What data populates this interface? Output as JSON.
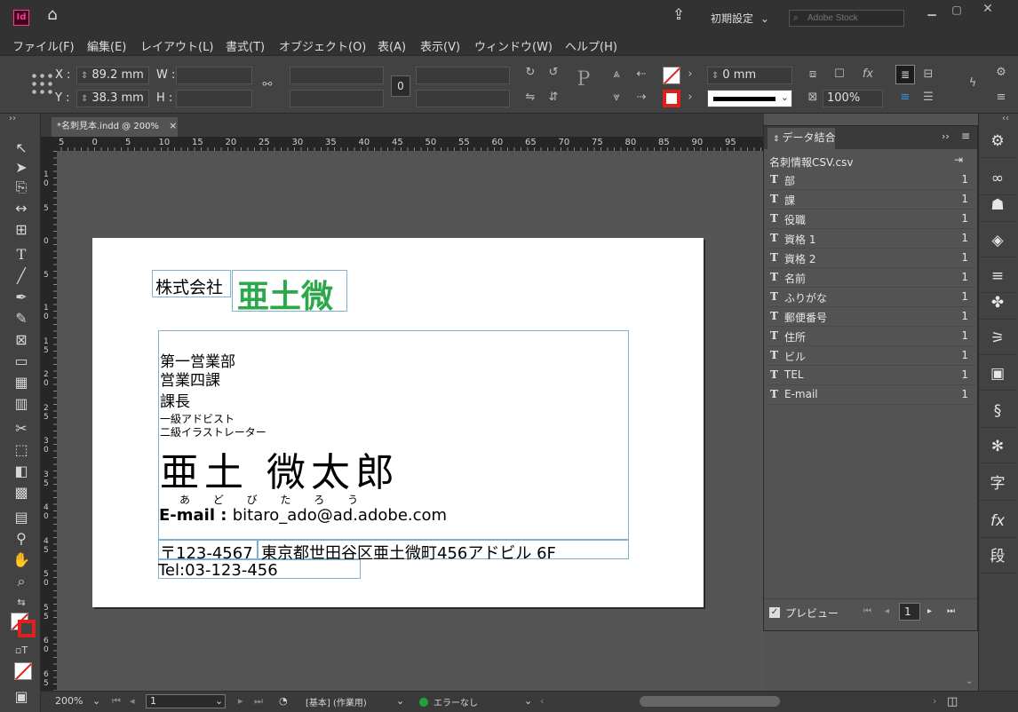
{
  "app": {
    "logo": "Id",
    "workspace": "初期設定",
    "search_placeholder": "Adobe Stock"
  },
  "menu": [
    "ファイル(F)",
    "編集(E)",
    "レイアウト(L)",
    "書式(T)",
    "オブジェクト(O)",
    "表(A)",
    "表示(V)",
    "ウィンドウ(W)",
    "ヘルプ(H)"
  ],
  "control": {
    "x_label": "X :",
    "x_value": "89.2 mm",
    "y_label": "Y :",
    "y_value": "38.3 mm",
    "w_label": "W :",
    "h_label": "H :",
    "stroke_weight": "0 mm",
    "scale": "100%"
  },
  "document": {
    "tab": "*名刺見本.indd @ 200%",
    "close": "×"
  },
  "ruler": {
    "h": [
      "5",
      "0",
      "5",
      "10",
      "15",
      "20",
      "25",
      "30",
      "35",
      "40",
      "45",
      "50",
      "55",
      "60",
      "65",
      "70",
      "75",
      "80",
      "85",
      "90",
      "95"
    ],
    "v": [
      "1\n0",
      "5",
      "0",
      "5",
      "1\n0",
      "1\n5",
      "2\n0",
      "2\n5",
      "3\n0",
      "3\n5",
      "4\n0",
      "4\n5",
      "5\n0",
      "5\n5",
      "6\n0",
      "6\n5"
    ]
  },
  "card": {
    "company": "株式会社",
    "company_name": "亜土微",
    "dept": "第一営業部",
    "section": "営業四課",
    "title": "課長",
    "qual1": "一級アドビスト",
    "qual2": "二級イラストレーター",
    "name": "亜土 微太郎",
    "ruby": "あ ど び た ろ う",
    "email_label": "E-mail : ",
    "email": "bitaro_ado@ad.adobe.com",
    "zip": "〒123-4567",
    "address": "東京都世田谷区亜土微町456アドビル 6F",
    "tel": "Tel:03-123-456"
  },
  "panel": {
    "title": "データ結合",
    "source": "名刺情報CSV.csv",
    "fields": [
      {
        "name": "部",
        "count": "1"
      },
      {
        "name": "課",
        "count": "1"
      },
      {
        "name": "役職",
        "count": "1"
      },
      {
        "name": "資格 1",
        "count": "1"
      },
      {
        "name": "資格 2",
        "count": "1"
      },
      {
        "name": "名前",
        "count": "1"
      },
      {
        "name": "ふりがな",
        "count": "1"
      },
      {
        "name": "郵便番号",
        "count": "1"
      },
      {
        "name": "住所",
        "count": "1"
      },
      {
        "name": "ビル",
        "count": "1"
      },
      {
        "name": "TEL",
        "count": "1"
      },
      {
        "name": "E-mail",
        "count": "1"
      }
    ],
    "preview_label": "プレビュー",
    "record": "1"
  },
  "status": {
    "zoom": "200%",
    "page": "1",
    "style": "[基本] (作業用)",
    "preflight": "エラーなし"
  },
  "colors": {
    "accent": "#e5488f",
    "green": "#22a33a",
    "company_green": "#2aa84a"
  }
}
